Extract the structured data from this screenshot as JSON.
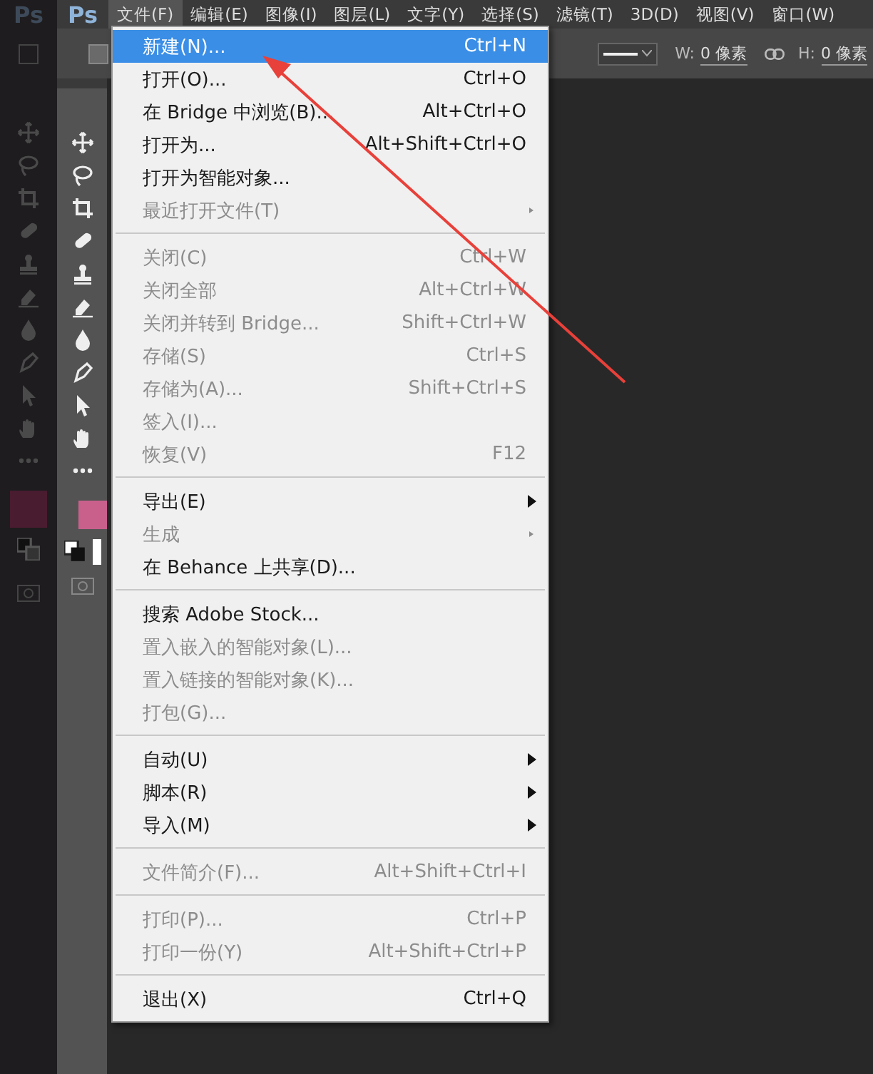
{
  "ghost_app": {
    "logo": "Ps"
  },
  "app": {
    "logo": "Ps"
  },
  "menubar": [
    {
      "label": "文件(F)",
      "selected": true
    },
    {
      "label": "编辑(E)",
      "selected": false
    },
    {
      "label": "图像(I)",
      "selected": false
    },
    {
      "label": "图层(L)",
      "selected": false
    },
    {
      "label": "文字(Y)",
      "selected": false
    },
    {
      "label": "选择(S)",
      "selected": false
    },
    {
      "label": "滤镜(T)",
      "selected": false
    },
    {
      "label": "3D(D)",
      "selected": false
    },
    {
      "label": "视图(V)",
      "selected": false
    },
    {
      "label": "窗口(W)",
      "selected": false
    }
  ],
  "options_bar": {
    "width_label": "W:",
    "width_value": "0 像素",
    "height_label": "H:",
    "height_value": "0 像素"
  },
  "file_menu": [
    {
      "kind": "item",
      "label": "新建(N)...",
      "shortcut": "Ctrl+N",
      "disabled": false,
      "submenu": false,
      "selected": true
    },
    {
      "kind": "item",
      "label": "打开(O)...",
      "shortcut": "Ctrl+O",
      "disabled": false,
      "submenu": false,
      "selected": false
    },
    {
      "kind": "item",
      "label": "在 Bridge 中浏览(B)...",
      "shortcut": "Alt+Ctrl+O",
      "disabled": false,
      "submenu": false,
      "selected": false
    },
    {
      "kind": "item",
      "label": "打开为...",
      "shortcut": "Alt+Shift+Ctrl+O",
      "disabled": false,
      "submenu": false,
      "selected": false
    },
    {
      "kind": "item",
      "label": "打开为智能对象...",
      "disabled": false,
      "submenu": false,
      "selected": false
    },
    {
      "kind": "item",
      "label": "最近打开文件(T)",
      "disabled": true,
      "submenu": true,
      "selected": false
    },
    {
      "kind": "separator"
    },
    {
      "kind": "item",
      "label": "关闭(C)",
      "shortcut": "Ctrl+W",
      "disabled": true,
      "submenu": false,
      "selected": false
    },
    {
      "kind": "item",
      "label": "关闭全部",
      "shortcut": "Alt+Ctrl+W",
      "disabled": true,
      "submenu": false,
      "selected": false
    },
    {
      "kind": "item",
      "label": "关闭并转到 Bridge...",
      "shortcut": "Shift+Ctrl+W",
      "disabled": true,
      "submenu": false,
      "selected": false
    },
    {
      "kind": "item",
      "label": "存储(S)",
      "shortcut": "Ctrl+S",
      "disabled": true,
      "submenu": false,
      "selected": false
    },
    {
      "kind": "item",
      "label": "存储为(A)...",
      "shortcut": "Shift+Ctrl+S",
      "disabled": true,
      "submenu": false,
      "selected": false
    },
    {
      "kind": "item",
      "label": "签入(I)...",
      "disabled": true,
      "submenu": false,
      "selected": false
    },
    {
      "kind": "item",
      "label": "恢复(V)",
      "shortcut": "F12",
      "disabled": true,
      "submenu": false,
      "selected": false
    },
    {
      "kind": "separator"
    },
    {
      "kind": "item",
      "label": "导出(E)",
      "disabled": false,
      "submenu": true,
      "selected": false
    },
    {
      "kind": "item",
      "label": "生成",
      "disabled": true,
      "submenu": true,
      "selected": false
    },
    {
      "kind": "item",
      "label": "在 Behance 上共享(D)...",
      "disabled": false,
      "submenu": false,
      "selected": false
    },
    {
      "kind": "separator"
    },
    {
      "kind": "item",
      "label": "搜索 Adobe Stock...",
      "disabled": false,
      "submenu": false,
      "selected": false
    },
    {
      "kind": "item",
      "label": "置入嵌入的智能对象(L)...",
      "disabled": true,
      "submenu": false,
      "selected": false
    },
    {
      "kind": "item",
      "label": "置入链接的智能对象(K)...",
      "disabled": true,
      "submenu": false,
      "selected": false
    },
    {
      "kind": "item",
      "label": "打包(G)...",
      "disabled": true,
      "submenu": false,
      "selected": false
    },
    {
      "kind": "separator"
    },
    {
      "kind": "item",
      "label": "自动(U)",
      "disabled": false,
      "submenu": true,
      "selected": false
    },
    {
      "kind": "item",
      "label": "脚本(R)",
      "disabled": false,
      "submenu": true,
      "selected": false
    },
    {
      "kind": "item",
      "label": "导入(M)",
      "disabled": false,
      "submenu": true,
      "selected": false
    },
    {
      "kind": "separator"
    },
    {
      "kind": "item",
      "label": "文件简介(F)...",
      "shortcut": "Alt+Shift+Ctrl+I",
      "disabled": true,
      "submenu": false,
      "selected": false
    },
    {
      "kind": "separator"
    },
    {
      "kind": "item",
      "label": "打印(P)...",
      "shortcut": "Ctrl+P",
      "disabled": true,
      "submenu": false,
      "selected": false
    },
    {
      "kind": "item",
      "label": "打印一份(Y)",
      "shortcut": "Alt+Shift+Ctrl+P",
      "disabled": true,
      "submenu": false,
      "selected": false
    },
    {
      "kind": "separator"
    },
    {
      "kind": "item",
      "label": "退出(X)",
      "shortcut": "Ctrl+Q",
      "disabled": false,
      "submenu": false,
      "selected": false
    }
  ]
}
